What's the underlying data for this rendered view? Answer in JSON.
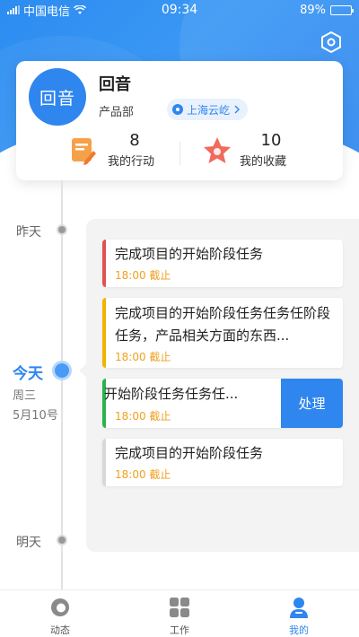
{
  "status_bar": {
    "carrier": "中国电信",
    "time": "09:34",
    "battery": "89%",
    "battery_level": 0.89
  },
  "header": {
    "settings_icon": "hexagon-settings-icon"
  },
  "profile": {
    "avatar_text": "回音",
    "name": "回音",
    "department": "产品部",
    "location": "上海云屹",
    "stats": [
      {
        "value": "8",
        "label": "我的行动",
        "icon": "notepad-pencil-icon"
      },
      {
        "value": "10",
        "label": "我的收藏",
        "icon": "star-icon"
      }
    ]
  },
  "timeline": {
    "yesterday": "昨天",
    "today": "今天",
    "today_weekday": "周三",
    "today_date": "5月10号",
    "tomorrow": "明天"
  },
  "tasks": [
    {
      "title": "完成项目的开始阶段任务",
      "due": "18:00 截止",
      "accent": "#e05252"
    },
    {
      "title": "完成项目的开始阶段任务任务任阶段任务，产品相关方面的东西...",
      "due": "18:00 截止",
      "accent": "#f0b400"
    },
    {
      "title": "开始阶段任务任务任...",
      "due": "18:00 截止",
      "accent": "#2bb24c",
      "action": "处理"
    },
    {
      "title": "完成项目的开始阶段任务",
      "due": "18:00 截止",
      "accent": "#d8d8d8"
    }
  ],
  "tabs": [
    {
      "label": "动态",
      "icon": "activity-ring-icon",
      "active": false
    },
    {
      "label": "工作",
      "icon": "grid-apps-icon",
      "active": false
    },
    {
      "label": "我的",
      "icon": "person-icon",
      "active": true
    }
  ],
  "colors": {
    "primary": "#2f86ee",
    "due": "#f0a020"
  }
}
